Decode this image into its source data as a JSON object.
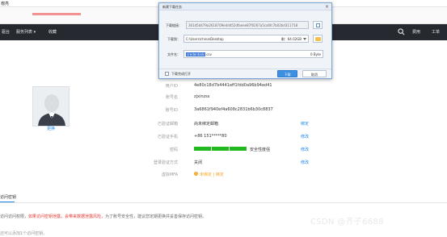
{
  "window": {
    "title": "瘤亮"
  },
  "nav": {
    "items": [
      "驱台",
      "服务列表 ▾",
      "收藏"
    ],
    "right": [
      "费用",
      "工单"
    ]
  },
  "profile": {
    "avatar_link": "更换",
    "rows": [
      {
        "label": "用户ID",
        "value": "4e80c18d7b4441eff1fdd0a96b94ed41",
        "action": ""
      },
      {
        "label": "账号名",
        "value": "zjxinzss",
        "action": ""
      },
      {
        "label": "账号ID",
        "value": "3a6861f940ef4a608c2831b6b30c8837",
        "action": ""
      },
      {
        "label": "已验证邮箱",
        "value": "尚未绑定邮箱",
        "action": "绑定"
      },
      {
        "label": "已验证手机",
        "value": "+86 151*****80",
        "action": "修改"
      },
      {
        "label": "密码",
        "value": "安全性度强",
        "action": "修改"
      },
      {
        "label": "登录验证方式",
        "value": "关闭",
        "action": "修改"
      },
      {
        "label": "虚拟MFA",
        "value": "未绑定 | 绑定",
        "action": ""
      }
    ],
    "password_strength": 0.75
  },
  "tab": {
    "label": "访问密钥"
  },
  "tip": {
    "prefix": "访问访问权限，",
    "red1": "如果访问密钥泄露，",
    "red2": "会带来数据泄露风险，",
    "suffix": "为了账号安全性，建议您定期更换并妥善保存访问密钥。"
  },
  "sub_tip": "还可以添加1个访问密钥。",
  "watermark": "CSDN @齐子6688",
  "dialog": {
    "title": "新建下载任务",
    "link_label": "下载链接：",
    "link_value": "361d5d479a2618709e4dd52dfaeee87f0267a5ca6fc7b02bd311718",
    "save_label": "下载到：",
    "save_path": "C:\\Users\\china\\Desktop",
    "free_space": "剩：64.02GB",
    "filename_label": "文件名：",
    "filename_selected": "credentials",
    "filename_ext": ".csv",
    "file_size": "0 Byte",
    "open_after_label": "下载完成打开",
    "download_button": "下载",
    "cancel_button": "取消"
  },
  "colors": {
    "accent": "#1e88e5",
    "nav_bg": "#262a30",
    "password_bar": "#1fb81f",
    "warning": "#f5a623",
    "danger": "#e53935"
  }
}
